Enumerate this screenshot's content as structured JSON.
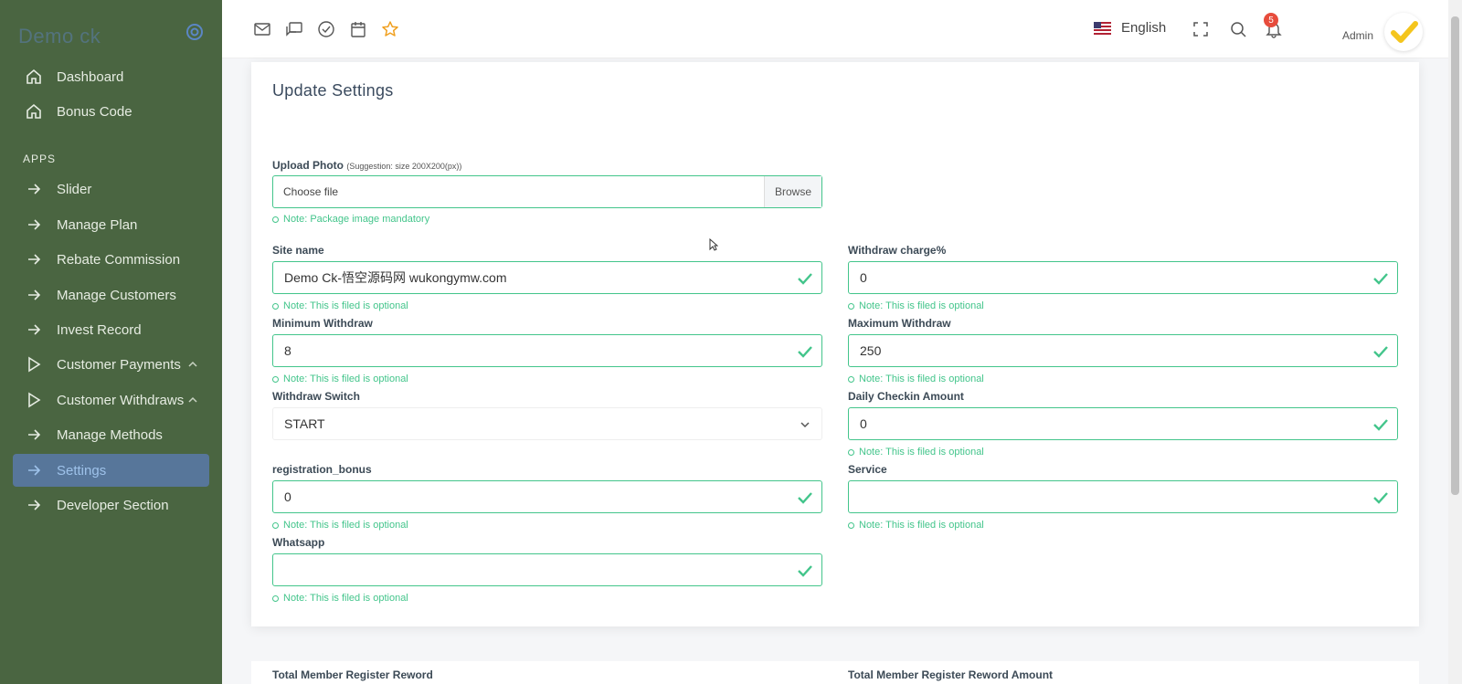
{
  "sidebar": {
    "brand": "Demo ck",
    "section_label": "APPS",
    "items": [
      {
        "label": "Dashboard",
        "icon": "home-icon"
      },
      {
        "label": "Bonus Code",
        "icon": "home-icon"
      },
      {
        "label": "Slider",
        "icon": "arrow-right-icon"
      },
      {
        "label": "Manage Plan",
        "icon": "arrow-right-icon"
      },
      {
        "label": "Rebate Commission",
        "icon": "arrow-right-icon"
      },
      {
        "label": "Manage Customers",
        "icon": "arrow-right-icon"
      },
      {
        "label": "Invest Record",
        "icon": "arrow-right-icon"
      },
      {
        "label": "Customer Payments",
        "icon": "play-icon"
      },
      {
        "label": "Customer Withdraws",
        "icon": "play-icon"
      },
      {
        "label": "Manage Methods",
        "icon": "arrow-right-icon"
      },
      {
        "label": "Settings",
        "icon": "arrow-right-icon"
      },
      {
        "label": "Developer Section",
        "icon": "arrow-right-icon"
      }
    ],
    "active_item": "Settings"
  },
  "topbar": {
    "language": "English",
    "notification_count": "5",
    "user_role": "Admin"
  },
  "form": {
    "title": "Update Settings",
    "upload": {
      "label": "Upload Photo",
      "hint": "(Suggestion: size 200X200(px))",
      "placeholder": "Choose file",
      "browse_label": "Browse",
      "note": "Note: Package image mandatory"
    },
    "site_name": {
      "label": "Site name",
      "value": "Demo Ck-悟空源码网 wukongymw.com",
      "note": "Note: This is filed is optional"
    },
    "withdraw_charge": {
      "label": "Withdraw charge%",
      "value": "0",
      "note": "Note: This is filed is optional"
    },
    "min_withdraw": {
      "label": "Minimum Withdraw",
      "value": "8",
      "note": "Note: This is filed is optional"
    },
    "max_withdraw": {
      "label": "Maximum Withdraw",
      "value": "250",
      "note": "Note: This is filed is optional"
    },
    "withdraw_switch": {
      "label": "Withdraw Switch",
      "value": "START"
    },
    "daily_checkin": {
      "label": "Daily Checkin Amount",
      "value": "0",
      "note": "Note: This is filed is optional"
    },
    "registration_bonus": {
      "label": "registration_bonus",
      "value": "0",
      "note": "Note: This is filed is optional"
    },
    "service": {
      "label": "Service",
      "value": "",
      "note": "Note: This is filed is optional"
    },
    "whatsapp": {
      "label": "Whatsapp",
      "value": "",
      "note": "Note: This is filed is optional"
    }
  },
  "form2": {
    "left_label": "Total Member Register Reword",
    "right_label": "Total Member Register Reword Amount"
  },
  "colors": {
    "sidebar_bg": "#4a6541",
    "active_bg": "#57769a",
    "success": "#43c58b",
    "badge": "#e74c3c",
    "star": "#f0a020"
  }
}
